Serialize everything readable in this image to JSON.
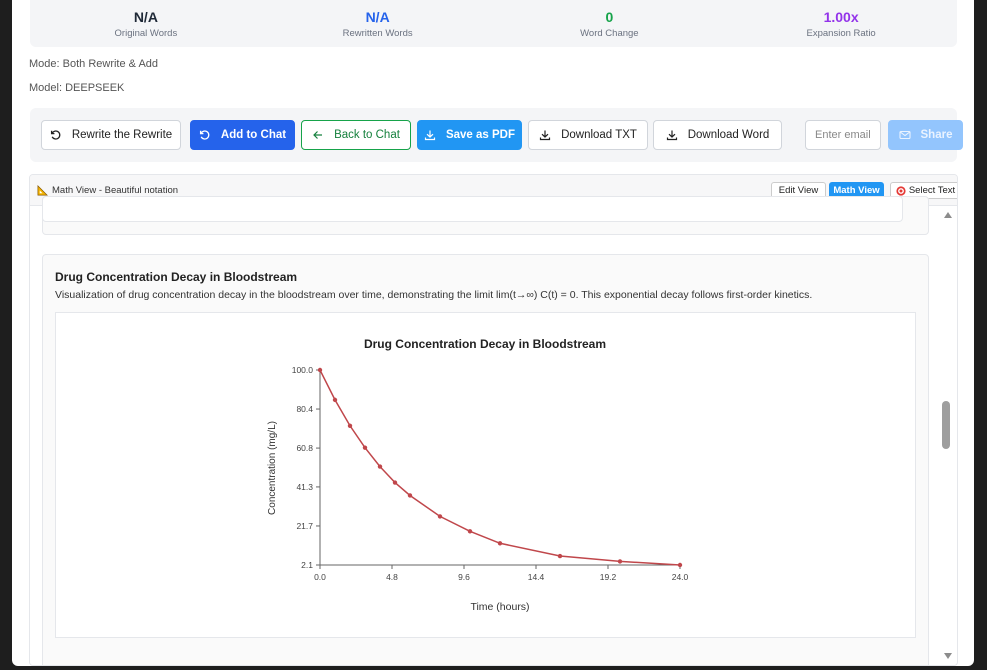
{
  "stats": [
    {
      "value": "N/A",
      "label": "Original Words",
      "color": "#1f2937"
    },
    {
      "value": "N/A",
      "label": "Rewritten Words",
      "color": "#2563eb"
    },
    {
      "value": "0",
      "label": "Word Change",
      "color": "#16a34a"
    },
    {
      "value": "1.00x",
      "label": "Expansion Ratio",
      "color": "#9333ea"
    }
  ],
  "meta": {
    "mode": "Mode: Both Rewrite & Add",
    "model": "Model: DEEPSEEK"
  },
  "actions": {
    "rewrite": "Rewrite the Rewrite",
    "add_to_chat": "Add to Chat",
    "back_to_chat": "Back to Chat",
    "save_pdf": "Save as PDF",
    "download_txt": "Download TXT",
    "download_word": "Download Word",
    "email_placeholder": "Enter email address",
    "share": "Share"
  },
  "view": {
    "title": "Math View - Beautiful notation",
    "edit_view": "Edit View",
    "math_view": "Math View",
    "select_text": "Select Text"
  },
  "card": {
    "title": "Drug Concentration Decay in Bloodstream",
    "description": "Visualization of drug concentration decay in the bloodstream over time, demonstrating the limit lim(t→∞) C(t) = 0. This exponential decay follows first-order kinetics."
  },
  "chart_data": {
    "type": "line",
    "title": "Drug Concentration Decay in Bloodstream",
    "xlabel": "Time (hours)",
    "ylabel": "Concentration (mg/L)",
    "xlim": [
      0,
      24
    ],
    "ylim": [
      2.1,
      100
    ],
    "x_ticks": [
      "0.0",
      "4.8",
      "9.6",
      "14.4",
      "19.2",
      "24.0"
    ],
    "y_ticks": [
      "2.1",
      "21.7",
      "41.3",
      "60.8",
      "80.4",
      "100.0"
    ],
    "grid": false,
    "series": [
      {
        "color": "#c0474b",
        "x": [
          0,
          1,
          2,
          3,
          4,
          5,
          6,
          8,
          10,
          12,
          16,
          20,
          24
        ],
        "y": [
          100,
          85.0,
          72.0,
          61.0,
          51.5,
          43.5,
          37.0,
          26.5,
          19.0,
          13.0,
          6.6,
          3.9,
          2.1
        ]
      }
    ]
  }
}
